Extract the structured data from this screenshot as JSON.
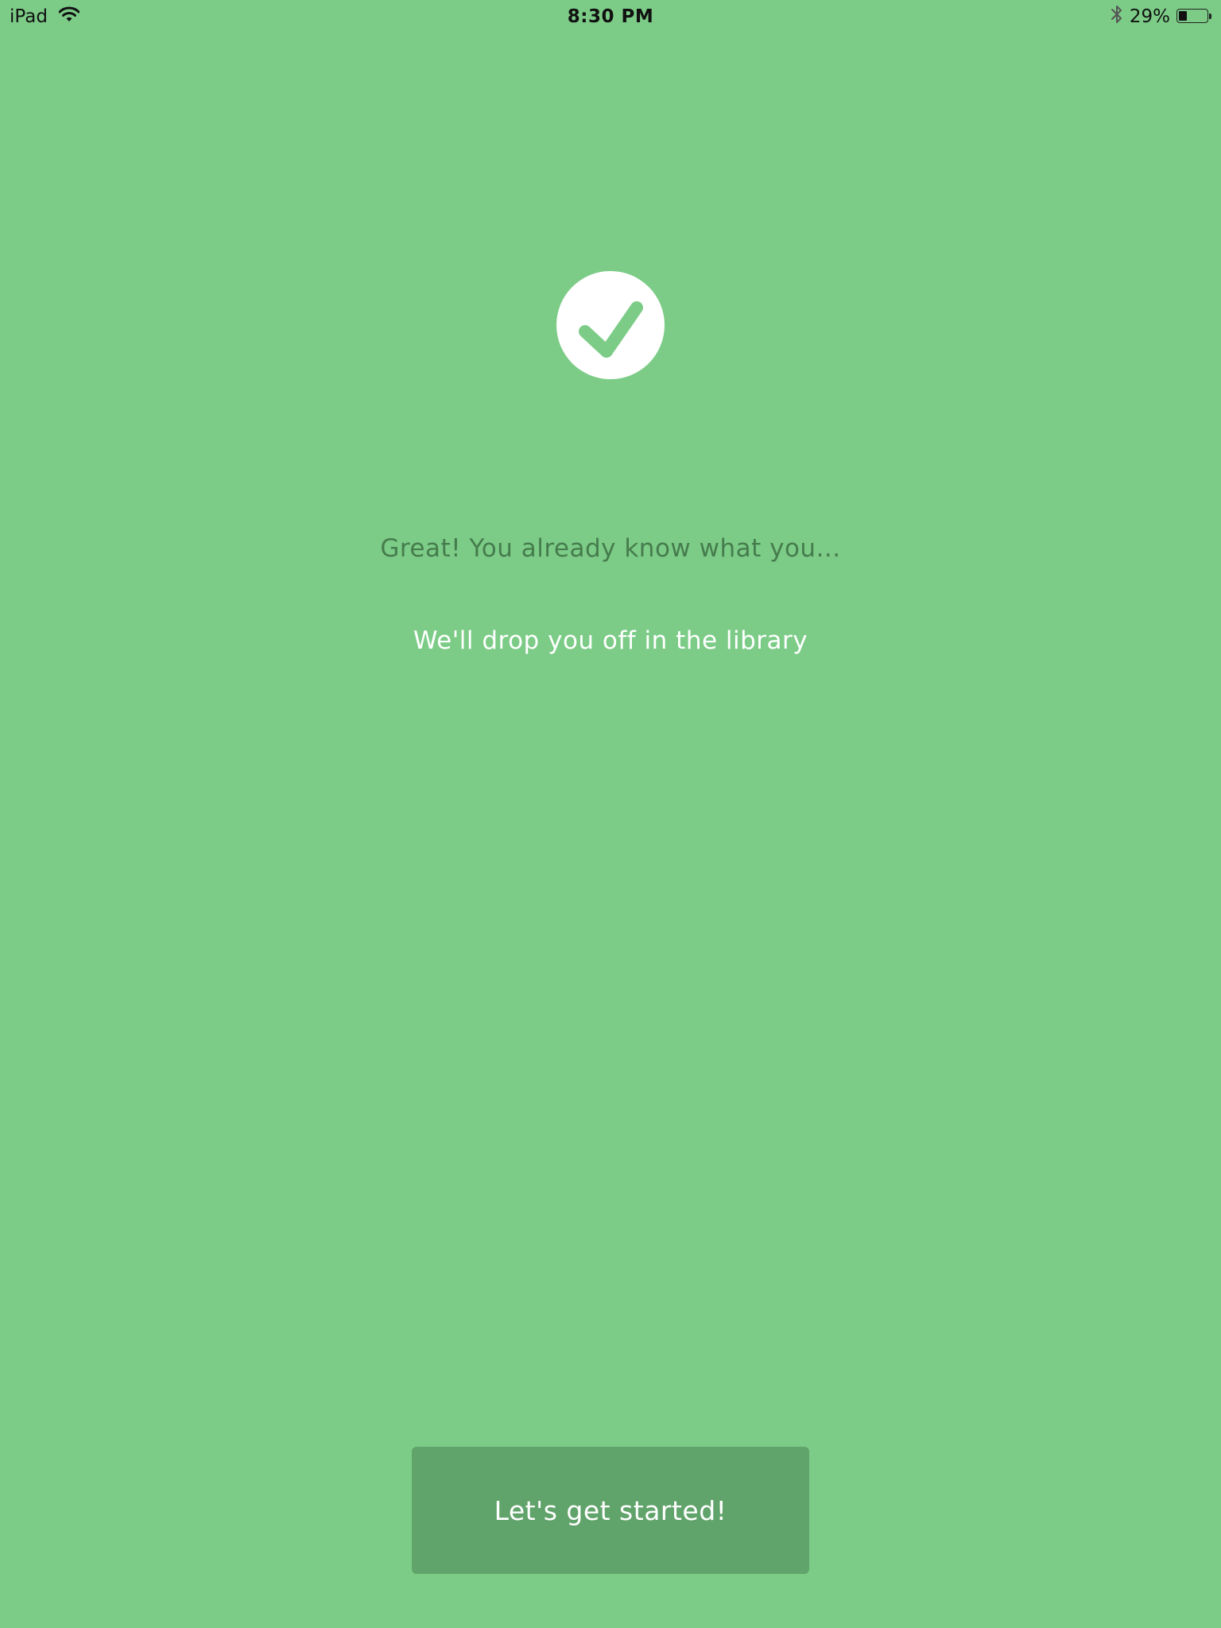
{
  "status_bar": {
    "device": "iPad",
    "time": "8:30 PM",
    "battery_percent_label": "29%",
    "battery_level": 0.29,
    "icons": [
      "wifi-icon",
      "bluetooth-icon",
      "battery-icon"
    ]
  },
  "main": {
    "icon": "checkmark-icon",
    "headline": "Great! You already know what you...",
    "subline": "We'll drop you off in the library",
    "cta_label": "Let's get started!"
  },
  "colors": {
    "background": "#7ccc87",
    "headline": "#467c4d",
    "button": "#61a46b",
    "text_light": "#ffffff"
  }
}
